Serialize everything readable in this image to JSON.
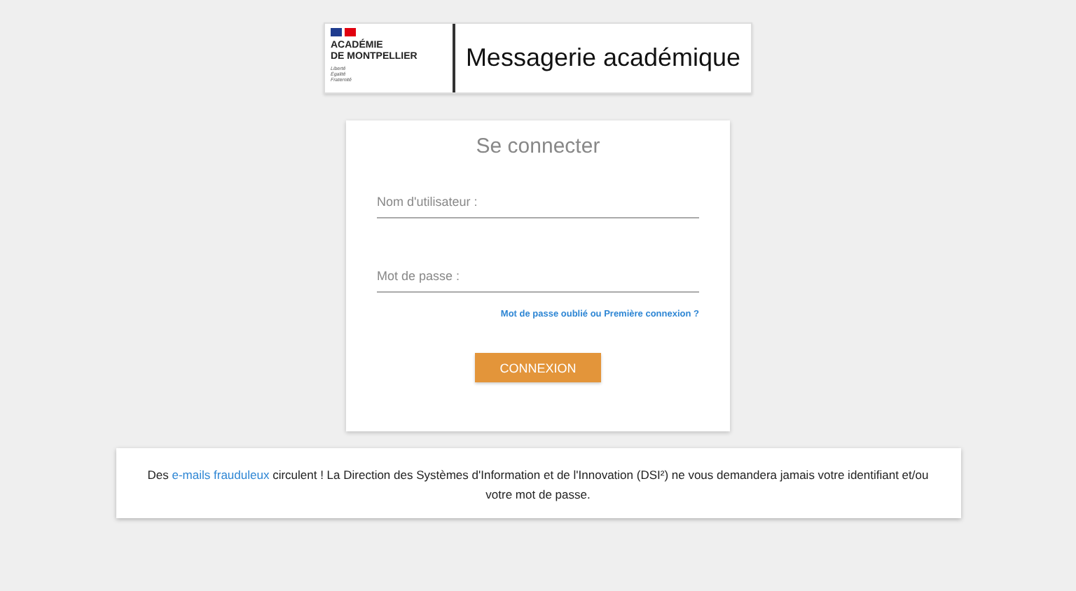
{
  "header": {
    "logo": {
      "line_1": "ACADÉMIE",
      "line_2": "DE MONTPELLIER",
      "motto": [
        "Liberté",
        "Égalité",
        "Fraternité"
      ]
    },
    "title": "Messagerie académique"
  },
  "login": {
    "title": "Se connecter",
    "fields": [
      {
        "placeholder": "Nom d'utilisateur :"
      },
      {
        "placeholder": "Mot de passe :"
      }
    ],
    "forgot_link": "Mot de passe oublié ou Première connexion ?",
    "submit": "CONNEXION"
  },
  "notice": {
    "before": "Des ",
    "link": "e-mails frauduleux",
    "after": " circulent ! La Direction des Systèmes d'Information et de l'Innovation (DSI²) ne vous demandera jamais votre identifiant et/ou votre mot de passe."
  }
}
